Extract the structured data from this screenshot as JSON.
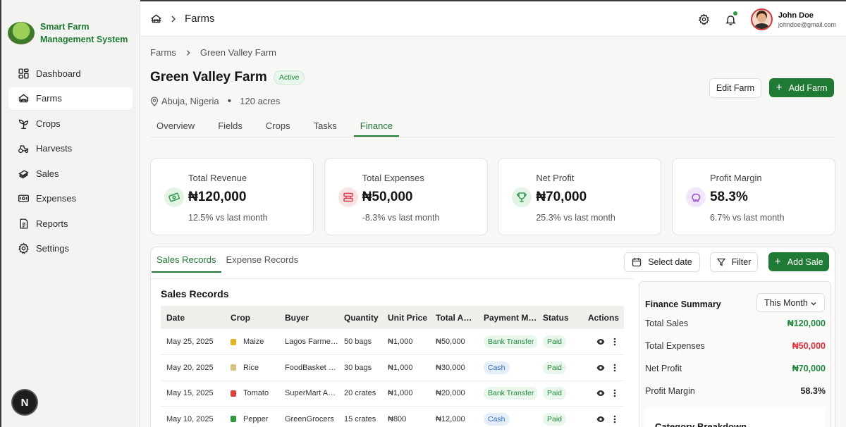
{
  "brand": {
    "line1": "Smart Farm",
    "line2": "Management System"
  },
  "sidebar": {
    "items": [
      {
        "label": "Dashboard",
        "icon": "dashboard-icon"
      },
      {
        "label": "Farms",
        "icon": "farm-icon",
        "active": true
      },
      {
        "label": "Crops",
        "icon": "sprout-icon"
      },
      {
        "label": "Harvests",
        "icon": "tractor-icon"
      },
      {
        "label": "Sales",
        "icon": "money-stack-icon"
      },
      {
        "label": "Expenses",
        "icon": "banknote-icon"
      },
      {
        "label": "Reports",
        "icon": "report-icon"
      },
      {
        "label": "Settings",
        "icon": "gear-icon"
      }
    ],
    "fab_label": "N"
  },
  "topbar": {
    "section": "Farms",
    "user": {
      "name": "John Doe",
      "email": "johndoe@gmail.com"
    }
  },
  "breadcrumb": {
    "parent": "Farms",
    "current": "Green Valley Farm"
  },
  "farm": {
    "name": "Green Valley Farm",
    "status": "Active",
    "location": "Abuja, Nigeria",
    "size": "120 acres"
  },
  "actions": {
    "edit": "Edit Farm",
    "add": "Add Farm"
  },
  "tabs": [
    "Overview",
    "Fields",
    "Crops",
    "Tasks",
    "Finance"
  ],
  "active_tab": "Finance",
  "stats": [
    {
      "label": "Total Revenue",
      "value": "₦120,000",
      "change": "12.5% vs last month",
      "color": "#2f9a4c",
      "bg": "#e3f4e7"
    },
    {
      "label": "Total Expenses",
      "value": "₦50,000",
      "change": "-8.3% vs last month",
      "color": "#d9434b",
      "bg": "#fbe3e4"
    },
    {
      "label": "Net Profit",
      "value": "₦70,000",
      "change": "25.3% vs last month",
      "color": "#2f9a4c",
      "bg": "#e3f4e7"
    },
    {
      "label": "Profit Margin",
      "value": "58.3%",
      "change": "6.7% vs last month",
      "color": "#9b4ed1",
      "bg": "#f1e6fa"
    }
  ],
  "records": {
    "tabs": [
      "Sales Records",
      "Expense Records"
    ],
    "select_date": "Select date",
    "filter": "Filter",
    "add_sale": "Add Sale",
    "title": "Sales Records",
    "columns": [
      "Date",
      "Crop",
      "Buyer",
      "Quantity",
      "Unit Price",
      "Total Amount",
      "Payment Method",
      "Status",
      "Actions"
    ],
    "rows": [
      {
        "date": "May 25, 2025",
        "crop": "Maize",
        "crop_color": "#e6b422",
        "buyer": "Lagos Farmers Market",
        "quantity": "50 bags",
        "unit_price": "₦1,000",
        "total": "₦50,000",
        "payment": "Bank Transfer",
        "payment_type": "bank",
        "status": "Paid"
      },
      {
        "date": "May 20, 2025",
        "crop": "Rice",
        "crop_color": "#d8c27a",
        "buyer": "FoodBasket Ltd",
        "quantity": "30 bags",
        "unit_price": "₦1,000",
        "total": "₦30,000",
        "payment": "Cash",
        "payment_type": "cash",
        "status": "Paid"
      },
      {
        "date": "May 15, 2025",
        "crop": "Tomato",
        "crop_color": "#e0413a",
        "buyer": "SuperMart Abuja",
        "quantity": "20 crates",
        "unit_price": "₦1,000",
        "total": "₦20,000",
        "payment": "Bank Transfer",
        "payment_type": "bank",
        "status": "Paid"
      },
      {
        "date": "May 10, 2025",
        "crop": "Pepper",
        "crop_color": "#2f9a3c",
        "buyer": "GreenGrocers",
        "quantity": "15 crates",
        "unit_price": "₦800",
        "total": "₦12,000",
        "payment": "Cash",
        "payment_type": "cash",
        "status": "Paid"
      }
    ]
  },
  "finance_summary": {
    "title": "Finance Summary",
    "period": "This Month",
    "rows": [
      {
        "label": "Total Sales",
        "value": "₦120,000",
        "color": "#1f8a3c"
      },
      {
        "label": "Total Expenses",
        "value": "₦50,000",
        "color": "#e0303a"
      },
      {
        "label": "Net Profit",
        "value": "₦70,000",
        "color": "#1f8a3c"
      },
      {
        "label": "Profit Margin",
        "value": "58.3%",
        "color": "#222222"
      }
    ],
    "category_title": "Category Breakdown"
  }
}
